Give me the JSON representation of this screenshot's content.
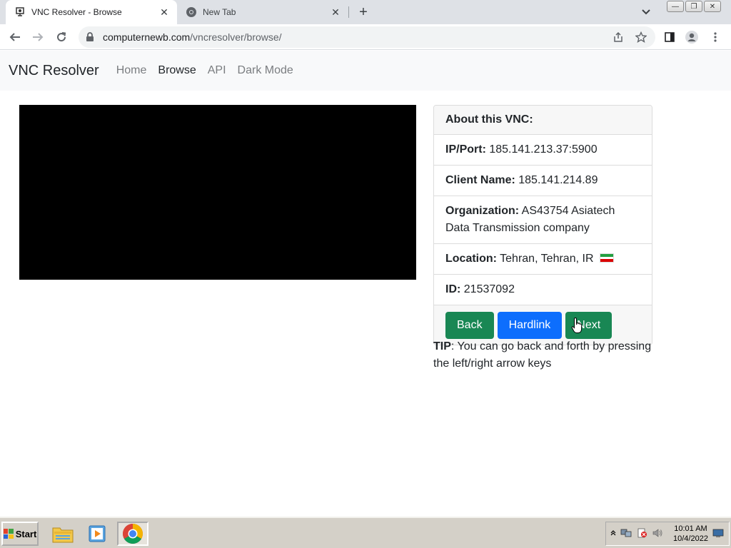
{
  "browser": {
    "tabs": [
      {
        "title": "VNC Resolver - Browse",
        "active": true
      },
      {
        "title": "New Tab",
        "active": false
      }
    ],
    "url": {
      "host": "computernewb.com",
      "path": "/vncresolver/browse/"
    }
  },
  "navbar": {
    "brand": "VNC Resolver",
    "links": [
      {
        "label": "Home",
        "active": false
      },
      {
        "label": "Browse",
        "active": true
      },
      {
        "label": "API",
        "active": false
      },
      {
        "label": "Dark Mode",
        "active": false
      }
    ]
  },
  "card": {
    "header": "About this VNC:",
    "rows": [
      {
        "label": "IP/Port:",
        "value": "185.141.213.37:5900"
      },
      {
        "label": "Client Name:",
        "value": "185.141.214.89"
      },
      {
        "label": "Organization:",
        "value": "AS43754 Asiatech Data Transmission company"
      },
      {
        "label": "Location:",
        "value": "Tehran, Tehran, IR"
      },
      {
        "label": "ID:",
        "value": "21537092"
      }
    ],
    "buttons": {
      "back": "Back",
      "hardlink": "Hardlink",
      "next": "Next"
    }
  },
  "tip": {
    "label": "TIP",
    "text": ": You can go back and forth by pressing the left/right arrow keys"
  },
  "taskbar": {
    "start_label": "Start",
    "time": "10:01 AM",
    "date": "10/4/2022"
  },
  "colors": {
    "green_button": "#198754",
    "blue_button": "#0d6efd",
    "vnc_screen": "#000000",
    "flag_iran": [
      "#239f40",
      "#ffffff",
      "#da0000"
    ]
  }
}
